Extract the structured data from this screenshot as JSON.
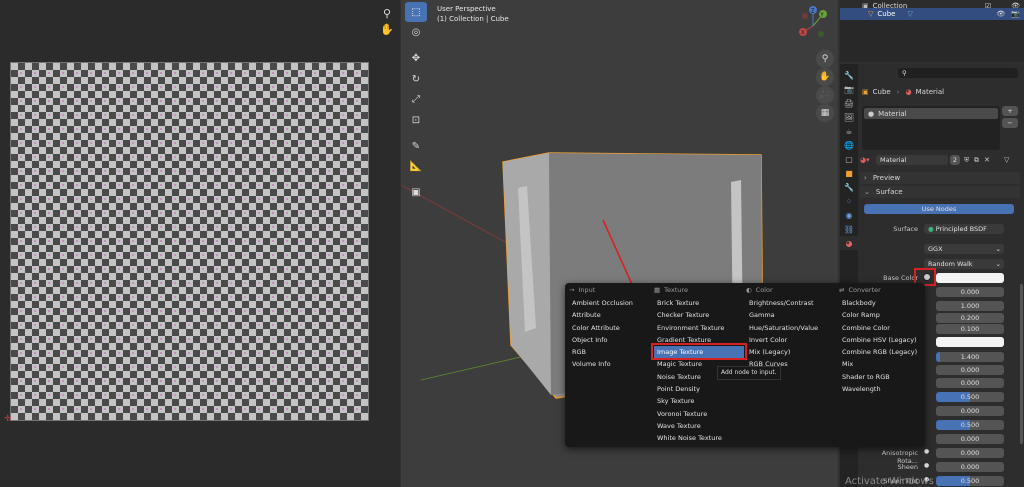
{
  "viewport": {
    "perspective_label": "User Perspective",
    "collection_label": "(1) Collection | Cube",
    "gizmo_axes": [
      "Y",
      "X",
      "Z"
    ]
  },
  "outliner": {
    "collection_label": "Collection",
    "cube_label": "Cube"
  },
  "properties": {
    "breadcrumb_object": "Cube",
    "breadcrumb_material": "Material",
    "material_slot": "Material",
    "material_name": "Material",
    "user_count": "2",
    "preview_label": "Preview",
    "surface_panel_label": "Surface",
    "use_nodes_label": "Use Nodes",
    "surface_label": "Surface",
    "surface_value": "Principled BSDF",
    "distribution": "GGX",
    "subsurface_method": "Random Walk",
    "base_color_label": "Base Color",
    "fields": [
      "0.000",
      "1.000",
      "0.200",
      "0.100",
      "",
      "1.400",
      "0.000",
      "0.000",
      "0.500",
      "0.000",
      "0.500",
      "0.000",
      "0.000",
      "0.000",
      "0.500"
    ],
    "aniso_rot_label": "Anisotropic Rota...",
    "sheen_label": "Sheen",
    "sheen_tint_label": "Sheen Tint"
  },
  "node_menu": {
    "columns": [
      {
        "header": "Input",
        "items": [
          "Ambient Occlusion",
          "Attribute",
          "Color Attribute",
          "Object Info",
          "RGB",
          "Volume Info"
        ]
      },
      {
        "header": "Texture",
        "items": [
          "Brick Texture",
          "Checker Texture",
          "Environment Texture",
          "Gradient Texture",
          "Image Texture",
          "Magic Texture",
          "Noise Texture",
          "Point Density",
          "Sky Texture",
          "Voronoi Texture",
          "Wave Texture",
          "White Noise Texture"
        ]
      },
      {
        "header": "Color",
        "items": [
          "Brightness/Contrast",
          "Gamma",
          "Hue/Saturation/Value",
          "Invert Color",
          "Mix (Legacy)",
          "RGB Curves"
        ]
      },
      {
        "header": "Converter",
        "items": [
          "Blackbody",
          "Color Ramp",
          "Combine Color",
          "Combine HSV (Legacy)",
          "Combine RGB (Legacy)",
          "Mix",
          "Shader to RGB",
          "Wavelength"
        ]
      }
    ],
    "highlighted": "Image Texture",
    "tooltip": "Add node to input."
  },
  "watermark": "Activate Windows",
  "colors": {
    "accent": "#4772b3",
    "selection_outline": "#f0a030",
    "annotation_red": "#d62222"
  }
}
